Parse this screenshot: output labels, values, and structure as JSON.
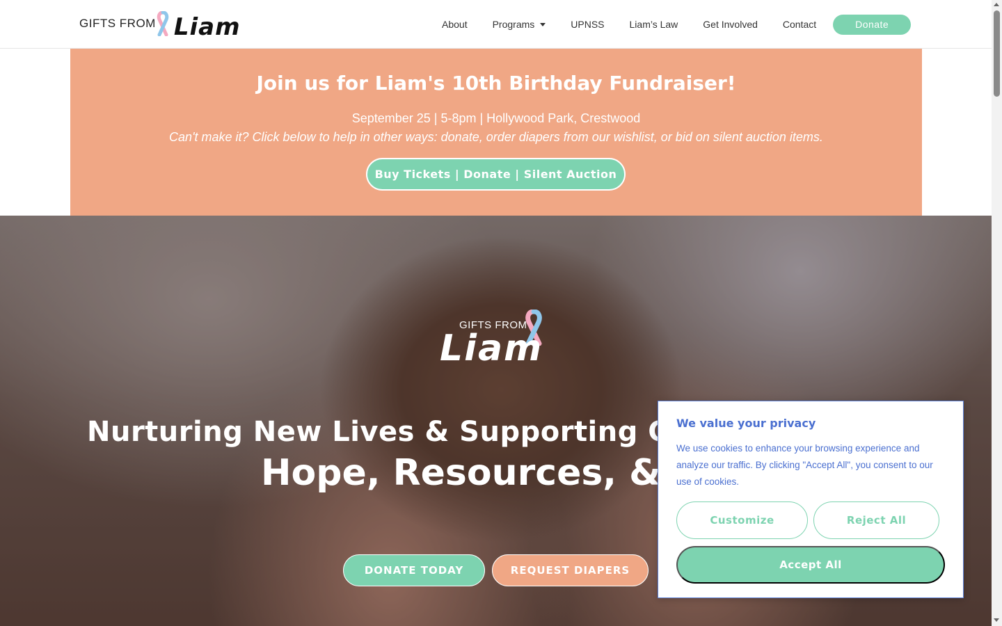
{
  "header": {
    "logo_small": "GIFTS FROM",
    "logo_big": "Liam",
    "nav": [
      {
        "label": "About"
      },
      {
        "label": "Programs"
      },
      {
        "label": "UPNSS"
      },
      {
        "label": "Liam’s Law"
      },
      {
        "label": "Get Involved"
      },
      {
        "label": "Contact"
      }
    ],
    "donate_label": "Donate"
  },
  "announcement": {
    "title": "Join us for Liam's 10th Birthday Fundraiser!",
    "subtitle": "September 25 | 5-8pm | Hollywood Park, Crestwood",
    "note": "Can't make it? Click below to help in other ways: donate, order diapers from our wishlist, or bid on silent auction items.",
    "button": "Buy Tickets | Donate | Silent Auction"
  },
  "hero": {
    "logo_small": "GIFTS FROM",
    "logo_big": "Liam",
    "tagline": "Nurturing New Lives & Supporting Griev",
    "headline": "Hope, Resources, & C",
    "buttons": {
      "donate_today": "DONATE TODAY",
      "request_diapers": "REQUEST DIAPERS"
    }
  },
  "cookie": {
    "title": "We value your privacy",
    "text": "We use cookies to enhance your browsing experience and analyze our traffic. By clicking \"Accept All\", you consent to our use of cookies.",
    "customize": "Customize",
    "reject": "Reject All",
    "accept": "Accept All"
  },
  "colors": {
    "accent_green": "#7dd3b0",
    "accent_peach": "#f0a785",
    "cookie_blue": "#4a6fd0"
  },
  "icons": {
    "ribbon": "awareness-ribbon-icon",
    "caret": "chevron-down-icon"
  }
}
